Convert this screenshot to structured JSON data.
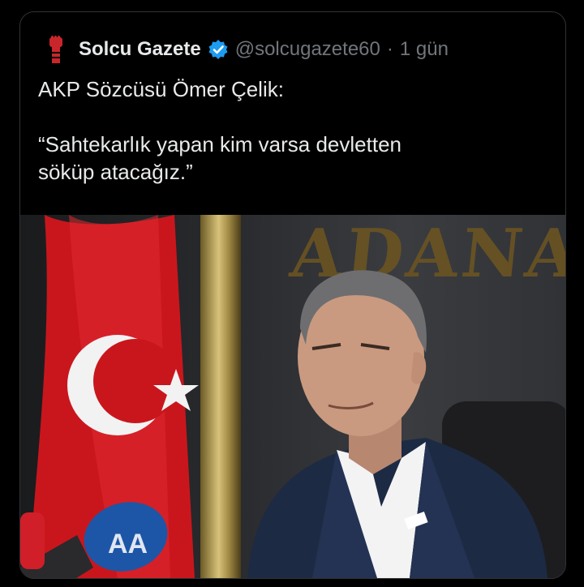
{
  "tweet": {
    "author_name": "Solcu Gazete",
    "handle": "@solcugazete60",
    "separator": "·",
    "time": "1 gün",
    "lines": [
      "AKP Sözcüsü Ömer Çelik:",
      "“Sahtekarlık yapan kim varsa devletten",
      "söküp atacağız.”"
    ]
  },
  "photo": {
    "sign_text": "ADANA",
    "mic_label": "AA"
  },
  "colors": {
    "background": "#000000",
    "text": "#e7e9ea",
    "muted": "#71767b",
    "verified": "#1d9bf0",
    "flag_red": "#d31b22"
  },
  "icons": [
    "fist-logo-icon",
    "verified-badge-icon"
  ]
}
